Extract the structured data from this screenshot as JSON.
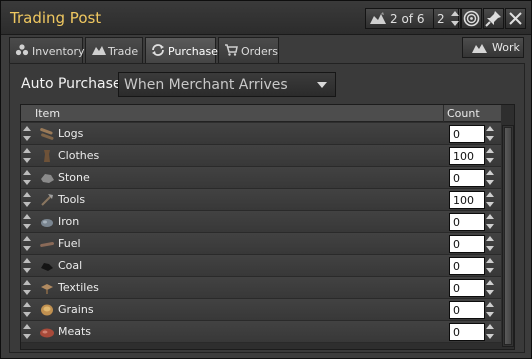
{
  "window": {
    "title": "Trading Post"
  },
  "titlebar": {
    "pager_text": "2 of 6",
    "count_value": "2"
  },
  "tabs": [
    {
      "label": "Inventory",
      "icon": "inventory-icon"
    },
    {
      "label": "Trade",
      "icon": "trade-icon"
    },
    {
      "label": "Purchase",
      "icon": "refresh-icon",
      "active": true
    },
    {
      "label": "Orders",
      "icon": "cart-icon"
    }
  ],
  "work_button": {
    "label": "Work",
    "icon": "worker-icon"
  },
  "auto_purchase": {
    "label": "Auto Purchase",
    "selected": "When Merchant Arrives"
  },
  "table": {
    "columns": {
      "item": "Item",
      "count": "Count"
    },
    "rows": [
      {
        "name": "Logs",
        "count": "0",
        "icon": "logs-icon"
      },
      {
        "name": "Clothes",
        "count": "100",
        "icon": "clothes-icon"
      },
      {
        "name": "Stone",
        "count": "0",
        "icon": "stone-icon"
      },
      {
        "name": "Tools",
        "count": "100",
        "icon": "tools-icon"
      },
      {
        "name": "Iron",
        "count": "0",
        "icon": "iron-icon"
      },
      {
        "name": "Fuel",
        "count": "0",
        "icon": "fuel-icon"
      },
      {
        "name": "Coal",
        "count": "0",
        "icon": "coal-icon"
      },
      {
        "name": "Textiles",
        "count": "0",
        "icon": "textiles-icon"
      },
      {
        "name": "Grains",
        "count": "0",
        "icon": "grains-icon"
      },
      {
        "name": "Meats",
        "count": "0",
        "icon": "meats-icon"
      }
    ]
  },
  "colors": {
    "title": "#f0c860",
    "background": "#3c3c3c"
  }
}
